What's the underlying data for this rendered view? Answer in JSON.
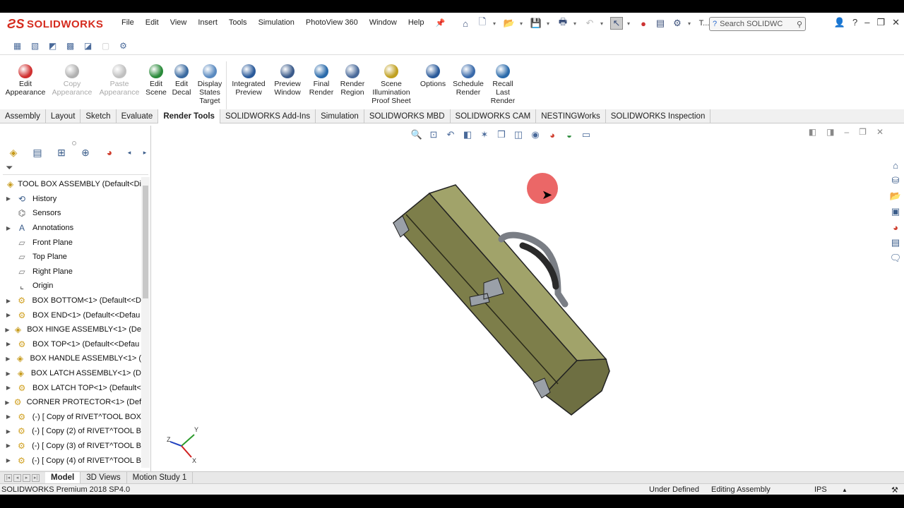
{
  "app": {
    "logo": "SOLIDWORKS"
  },
  "menu": [
    "File",
    "Edit",
    "View",
    "Insert",
    "Tools",
    "Simulation",
    "PhotoView 360",
    "Window",
    "Help"
  ],
  "search": {
    "placeholder": "Search SOLIDWC"
  },
  "truncated_t": "T...",
  "ribbon": [
    {
      "label": "Edit\nAppearance",
      "enabled": true,
      "color": "#d03030"
    },
    {
      "label": "Copy\nAppearance",
      "enabled": false,
      "color": "#b0b0b0"
    },
    {
      "label": "Paste\nAppearance",
      "enabled": false,
      "color": "#c0c0c0"
    },
    {
      "label": "Edit\nScene",
      "enabled": true,
      "color": "#2a8a3a"
    },
    {
      "label": "Edit\nDecal",
      "enabled": true,
      "color": "#3a6aa0"
    },
    {
      "label": "Display\nStates\nTarget",
      "enabled": true,
      "color": "#5a8ac0"
    },
    {
      "label": "Integrated\nPreview",
      "enabled": true,
      "color": "#2a5a9a"
    },
    {
      "label": "Preview\nWindow",
      "enabled": true,
      "color": "#3a5a8a"
    },
    {
      "label": "Final\nRender",
      "enabled": true,
      "color": "#2a6aaa"
    },
    {
      "label": "Render\nRegion",
      "enabled": true,
      "color": "#4a6a9a"
    },
    {
      "label": "Scene\nIllumination\nProof Sheet",
      "enabled": true,
      "color": "#c0a020"
    },
    {
      "label": "Options",
      "enabled": true,
      "color": "#2a5a9a"
    },
    {
      "label": "Schedule\nRender",
      "enabled": true,
      "color": "#3a6aaa"
    },
    {
      "label": "Recall\nLast\nRender",
      "enabled": true,
      "color": "#2a6aaa"
    }
  ],
  "tabs": [
    {
      "label": "Assembly",
      "active": false
    },
    {
      "label": "Layout",
      "active": false
    },
    {
      "label": "Sketch",
      "active": false
    },
    {
      "label": "Evaluate",
      "active": false
    },
    {
      "label": "Render Tools",
      "active": true
    },
    {
      "label": "SOLIDWORKS Add-Ins",
      "active": false
    },
    {
      "label": "Simulation",
      "active": false
    },
    {
      "label": "SOLIDWORKS MBD",
      "active": false
    },
    {
      "label": "SOLIDWORKS CAM",
      "active": false
    },
    {
      "label": "NESTINGWorks",
      "active": false
    },
    {
      "label": "SOLIDWORKS Inspection",
      "active": false
    }
  ],
  "tree": [
    {
      "label": "TOOL BOX ASSEMBLY  (Default<Di",
      "icon": "assembly",
      "expander": false,
      "root": true
    },
    {
      "label": "History",
      "icon": "history",
      "expander": true
    },
    {
      "label": "Sensors",
      "icon": "sensor",
      "expander": false
    },
    {
      "label": "Annotations",
      "icon": "annotation",
      "expander": true
    },
    {
      "label": "Front Plane",
      "icon": "plane",
      "expander": false
    },
    {
      "label": "Top Plane",
      "icon": "plane",
      "expander": false
    },
    {
      "label": "Right Plane",
      "icon": "plane",
      "expander": false
    },
    {
      "label": "Origin",
      "icon": "origin",
      "expander": false
    },
    {
      "label": "BOX BOTTOM<1> (Default<<D",
      "icon": "part",
      "expander": true
    },
    {
      "label": "BOX END<1> (Default<<Defau",
      "icon": "part",
      "expander": true
    },
    {
      "label": "BOX HINGE ASSEMBLY<1> (De",
      "icon": "subassembly",
      "expander": true
    },
    {
      "label": "BOX TOP<1> (Default<<Defau",
      "icon": "part",
      "expander": true
    },
    {
      "label": "BOX HANDLE ASSEMBLY<1> (",
      "icon": "subassembly",
      "expander": true
    },
    {
      "label": "BOX LATCH ASSEMBLY<1> (D",
      "icon": "subassembly",
      "expander": true
    },
    {
      "label": "BOX LATCH TOP<1> (Default<",
      "icon": "part",
      "expander": true
    },
    {
      "label": "CORNER PROTECTOR<1> (Def",
      "icon": "part",
      "expander": true
    },
    {
      "label": "(-) [ Copy of RIVET^TOOL BOX",
      "icon": "part",
      "expander": true
    },
    {
      "label": "(-) [ Copy (2) of RIVET^TOOL B",
      "icon": "part",
      "expander": true
    },
    {
      "label": "(-) [ Copy (3) of RIVET^TOOL B",
      "icon": "part",
      "expander": true
    },
    {
      "label": "(-) [ Copy (4) of RIVET^TOOL B",
      "icon": "part",
      "expander": true
    }
  ],
  "bottom_tabs": [
    {
      "label": "Model",
      "active": true
    },
    {
      "label": "3D Views",
      "active": false
    },
    {
      "label": "Motion Study 1",
      "active": false
    }
  ],
  "status": {
    "product": "SOLIDWORKS Premium 2018 SP4.0",
    "state": "Under Defined",
    "mode": "Editing Assembly",
    "units": "IPS"
  },
  "triad": {
    "x": "X",
    "y": "Y",
    "z": "Z"
  },
  "colors": {
    "model_body": "#7d7e4a",
    "model_top": "#a1a36a",
    "accent": "#d52b1e",
    "cursor_highlight": "#e84c4c"
  }
}
